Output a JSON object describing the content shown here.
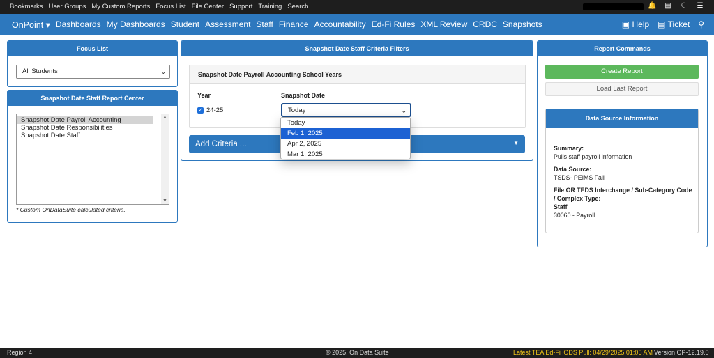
{
  "topbar": {
    "links": [
      "Bookmarks",
      "User Groups",
      "My Custom Reports",
      "Focus List",
      "File Center",
      "Support",
      "Training",
      "Search"
    ],
    "icons": [
      "bell-icon",
      "print-icon",
      "moon-icon",
      "menu-icon"
    ]
  },
  "nav": {
    "brand": "OnPoint ▾",
    "items": [
      "Dashboards",
      "My Dashboards",
      "Student",
      "Assessment",
      "Staff",
      "Finance",
      "Accountability",
      "Ed-Fi Rules",
      "XML Review",
      "CRDC",
      "Snapshots"
    ],
    "help": "Help",
    "ticket": "Ticket"
  },
  "focus": {
    "title": "Focus List",
    "selected": "All Students"
  },
  "report_center": {
    "title": "Snapshot Date Staff Report Center",
    "items": [
      "Snapshot Date Payroll Accounting",
      "Snapshot Date Responsibilities",
      "Snapshot Date Staff"
    ],
    "note": "* Custom OnDataSuite calculated criteria."
  },
  "criteria": {
    "title": "Snapshot Date Staff Criteria Filters",
    "subtitle": "Snapshot Date Payroll Accounting School Years",
    "year_label": "Year",
    "snapshot_label": "Snapshot Date",
    "year_value": "24-25",
    "snapshot_selected": "Today",
    "options": [
      "Today",
      "Feb 1, 2025",
      "Apr 2, 2025",
      "Mar 1, 2025"
    ],
    "add_criteria": "Add Criteria ..."
  },
  "commands": {
    "title": "Report Commands",
    "create": "Create Report",
    "load": "Load Last Report",
    "ds_title": "Data Source Information",
    "summary_label": "Summary:",
    "summary": "Pulls staff payroll information",
    "source_label": "Data Source:",
    "source": "TSDS- PEIMS Fall",
    "interchange_label_1": "File OR TEDS Interchange / Sub-Category Code",
    "interchange_label_2": "/ Complex Type:",
    "interchange_1": "Staff",
    "interchange_2": "30060 - Payroll"
  },
  "footer": {
    "left": "Region 4",
    "center": "© 2025, On Data Suite",
    "pull": "Latest TEA Ed-Fi iODS Pull: 04/29/2025 01:05 AM",
    "version": "Version OP-12.19.0"
  }
}
